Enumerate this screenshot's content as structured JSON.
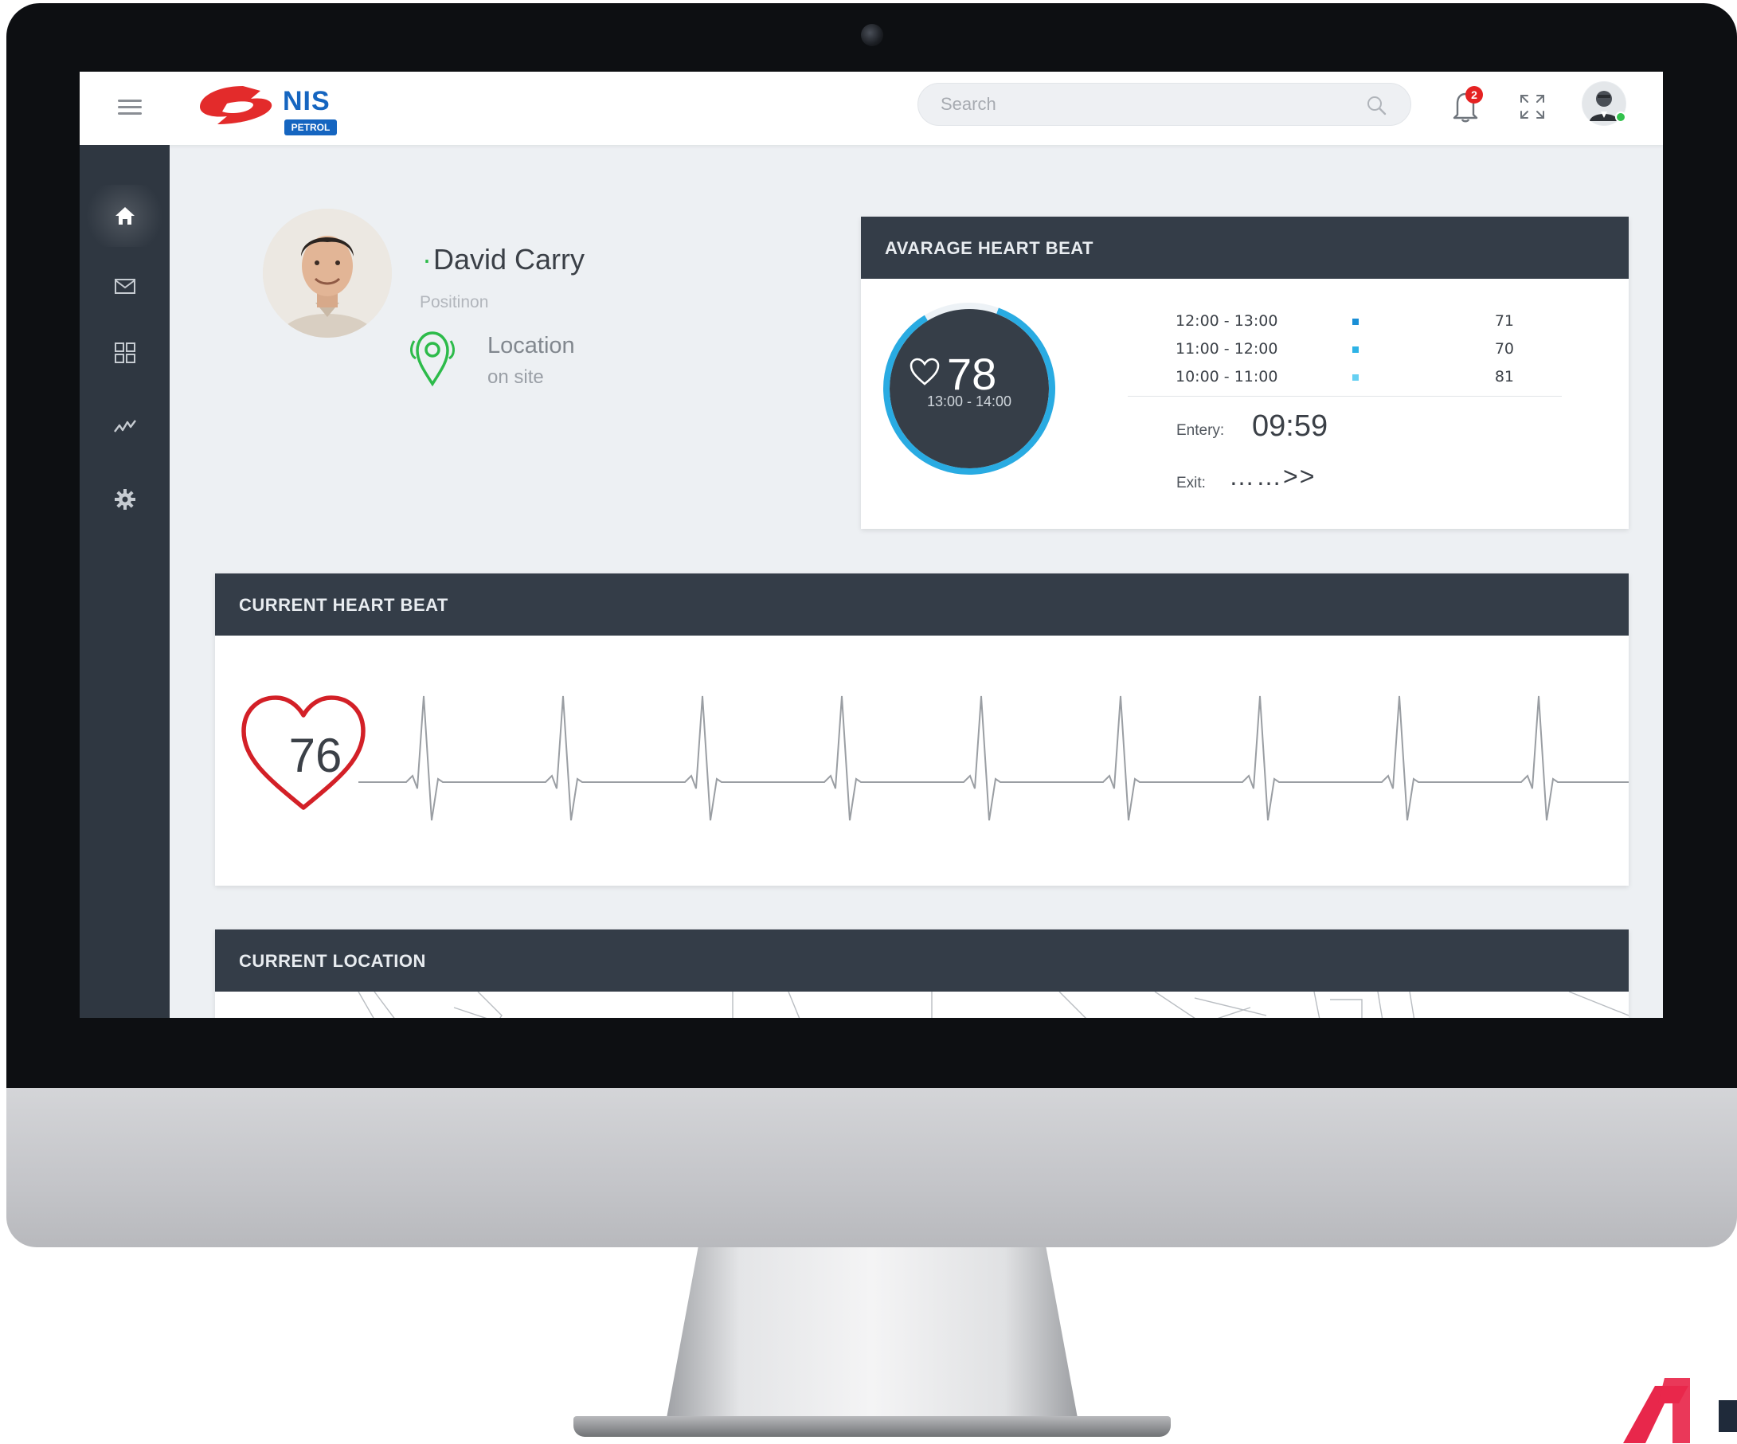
{
  "brand": {
    "logo_text": "NIS",
    "logo_subtext": "PETROL"
  },
  "topbar": {
    "search_placeholder": "Search",
    "notification_count": "2"
  },
  "sidebar": {
    "items": [
      {
        "icon": "home-icon",
        "active": true
      },
      {
        "icon": "mail-icon",
        "active": false
      },
      {
        "icon": "grid-icon",
        "active": false
      },
      {
        "icon": "activity-icon",
        "active": false
      },
      {
        "icon": "gear-icon",
        "active": false
      }
    ]
  },
  "profile": {
    "name": "David Carry",
    "position": "Positinon",
    "location_label": "Location",
    "location_value": "on site"
  },
  "avg_heart_beat": {
    "title": "AVARAGE HEART BEAT",
    "value": "78",
    "range": "13:00 - 14:00",
    "rows": [
      {
        "time": "12:00 - 13:00",
        "value": "71",
        "color": "#1a8fd6"
      },
      {
        "time": "11:00 - 12:00",
        "value": "70",
        "color": "#2eb3e6"
      },
      {
        "time": "10:00 - 11:00",
        "value": "81",
        "color": "#66d0f2"
      }
    ],
    "entry_label": "Entery:",
    "entry_value": "09:59",
    "exit_label": "Exit:",
    "exit_value": "……>>"
  },
  "current_heart_beat": {
    "title": "CURRENT HEART BEAT",
    "value": "76"
  },
  "current_location": {
    "title": "CURRENT LOCATION"
  },
  "colors": {
    "sidebar_bg": "#2f3741",
    "card_header_bg": "#343d48",
    "accent_blue": "#29abe2",
    "heart_red": "#d32027",
    "online_green": "#2dbb4a"
  }
}
